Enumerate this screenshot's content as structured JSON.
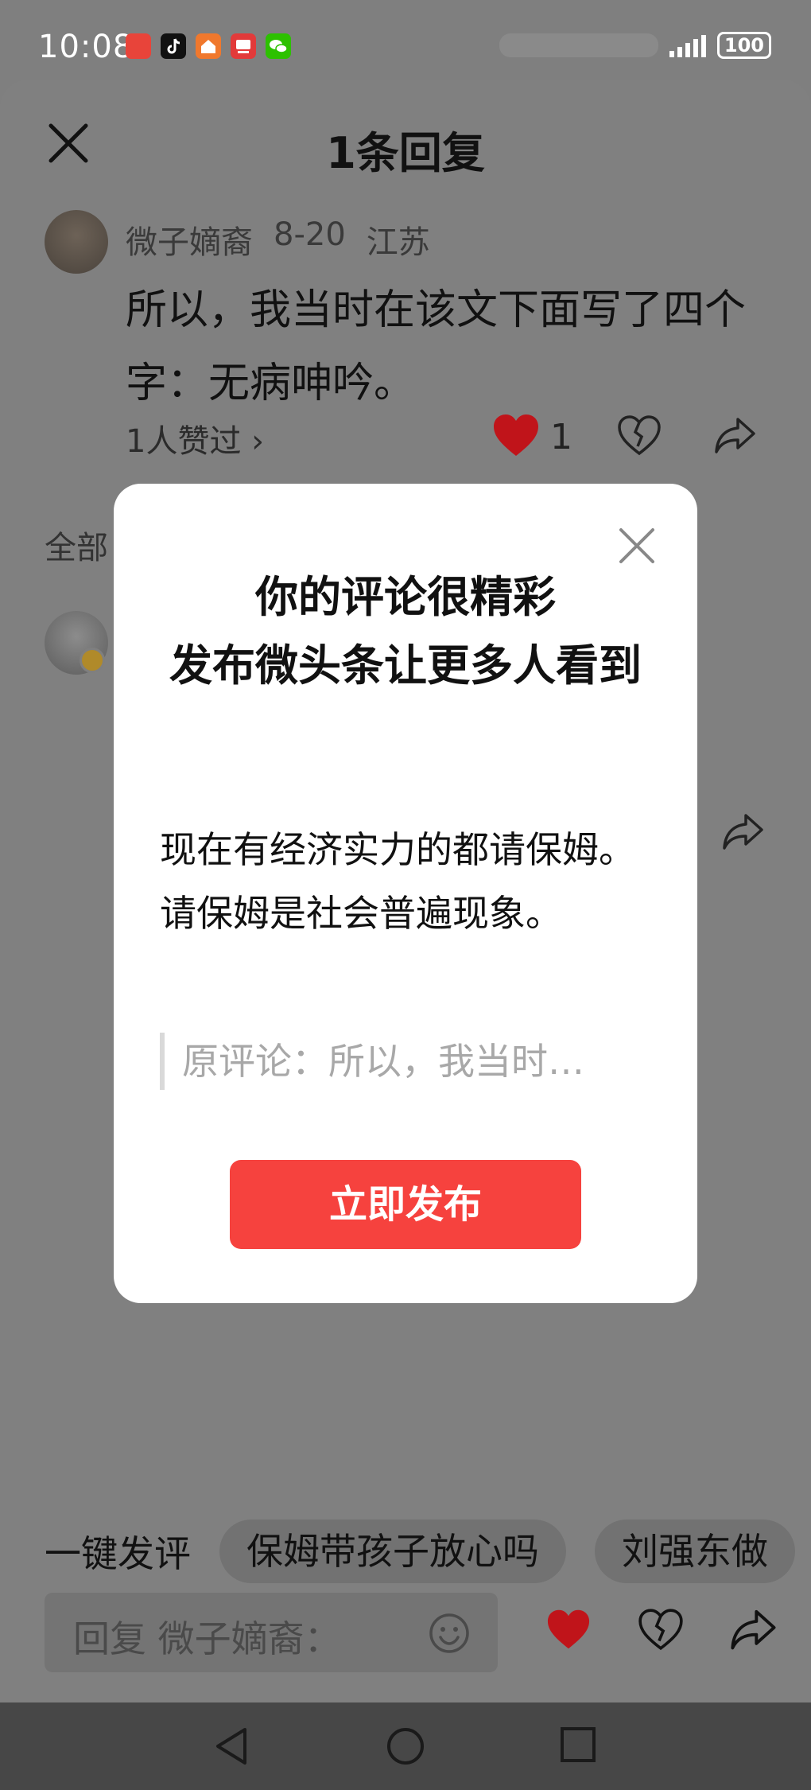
{
  "status_bar": {
    "time": "10:08",
    "battery": "100",
    "app_icons": [
      {
        "name": "huawei-video-icon",
        "color": "#e8443a"
      },
      {
        "name": "douyin-icon",
        "color": "#111111"
      },
      {
        "name": "home-app-icon",
        "color": "#f0782d"
      },
      {
        "name": "news-app-icon",
        "color": "#e23a3a"
      },
      {
        "name": "wechat-icon",
        "color": "#2dc100"
      }
    ]
  },
  "sheet": {
    "title": "1条回复"
  },
  "comment": {
    "author": "微子嫡裔",
    "date": "8-20",
    "location": "江苏",
    "body": "所以，我当时在该文下面写了四个字：无病呻吟。",
    "likes_text": "1人赞过 ›",
    "like_count": "1"
  },
  "all_label": "全部",
  "modal": {
    "title_line1": "你的评论很精彩",
    "title_line2": "发布微头条让更多人看到",
    "text": "现在有经济实力的都请保姆。请保姆是社会普遍现象。",
    "quote": "原评论：所以，我当时…",
    "publish_label": "立即发布"
  },
  "chips": {
    "label": "一键发评",
    "items": [
      "保姆带孩子放心吗",
      "刘强东做"
    ]
  },
  "reply_bar": {
    "placeholder": "回复 微子嫡裔："
  },
  "colors": {
    "accent_red": "#f6423e",
    "heart_red": "#c0141a"
  }
}
